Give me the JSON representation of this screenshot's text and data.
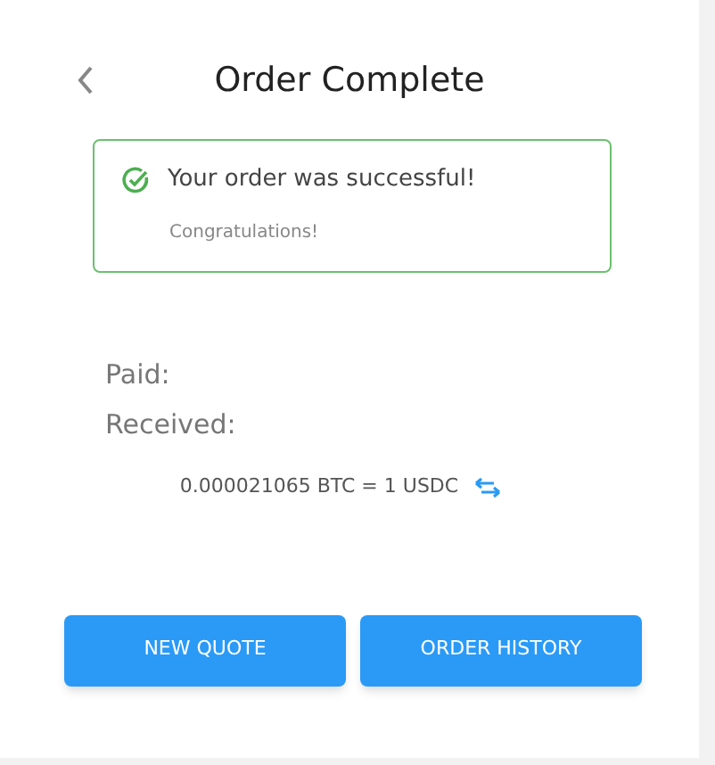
{
  "header": {
    "title": "Order Complete"
  },
  "alert": {
    "message": "Your order was successful!",
    "detail": "Congratulations!"
  },
  "summary": [
    {
      "label": "Paid:"
    },
    {
      "label": "Received:"
    }
  ],
  "rate": "0.000021065 BTC = 1 USDC",
  "buttons": [
    "NEW QUOTE",
    "ORDER HISTORY"
  ]
}
